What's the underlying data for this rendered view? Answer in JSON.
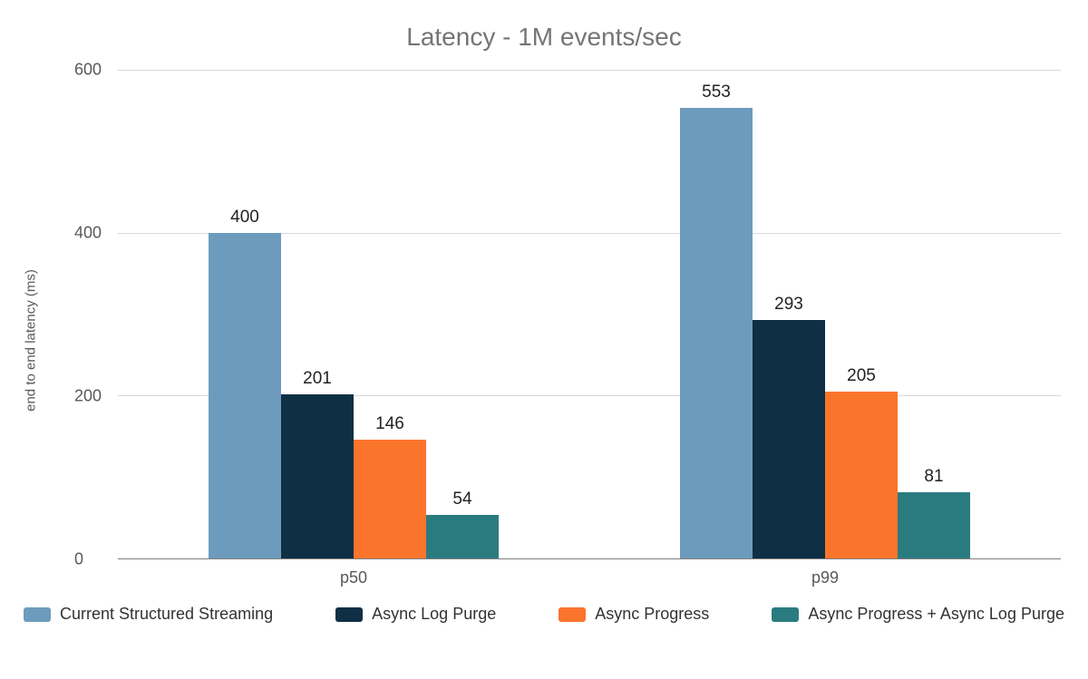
{
  "chart_data": {
    "type": "bar",
    "title": "Latency - 1M events/sec",
    "ylabel": "end to end latency (ms)",
    "xlabel": "",
    "categories": [
      "p50",
      "p99"
    ],
    "series": [
      {
        "name": "Current Structured Streaming",
        "color": "#6d9bbd",
        "values": [
          400,
          553
        ]
      },
      {
        "name": "Async Log Purge",
        "color": "#0e2f44",
        "values": [
          201,
          293
        ]
      },
      {
        "name": "Async Progress",
        "color": "#fb742c",
        "values": [
          146,
          205
        ]
      },
      {
        "name": "Async Progress + Async Log Purge",
        "color": "#2a7b7f",
        "values": [
          54,
          81
        ]
      }
    ],
    "ylim": [
      0,
      600
    ],
    "yticks": [
      0,
      200,
      400,
      600
    ]
  }
}
